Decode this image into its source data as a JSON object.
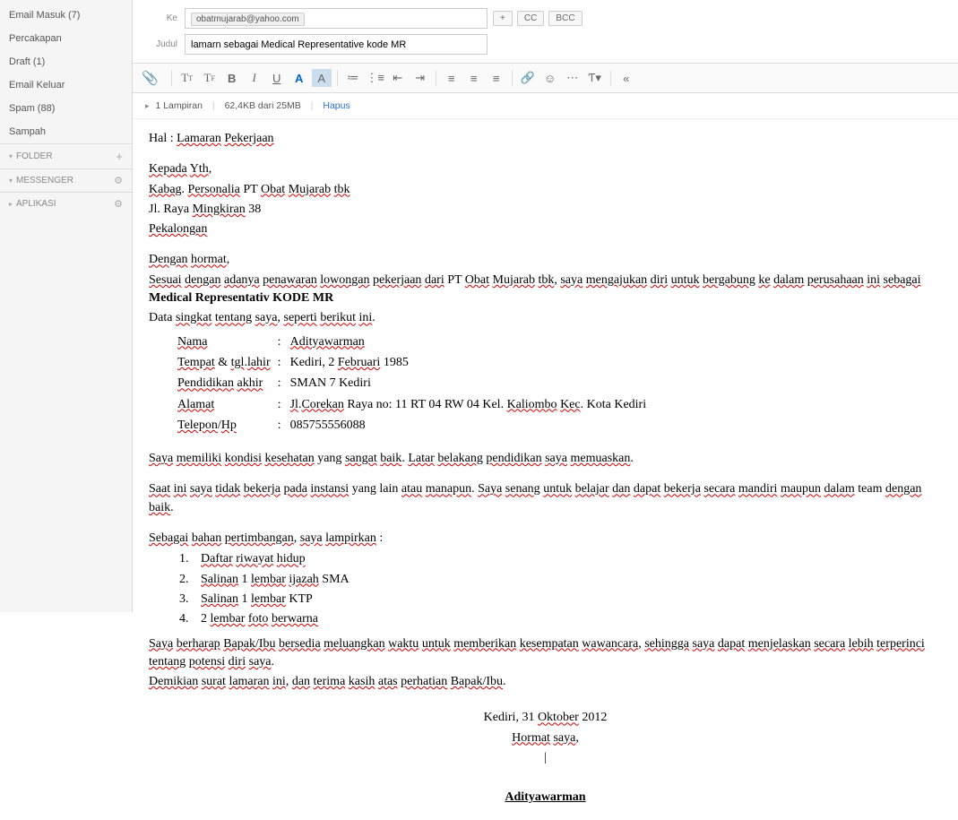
{
  "sidebar": {
    "items": [
      {
        "label": "Email Masuk (7)"
      },
      {
        "label": "Percakapan"
      },
      {
        "label": "Draft (1)"
      },
      {
        "label": "Email Keluar"
      },
      {
        "label": "Spam (88)"
      },
      {
        "label": "Sampah"
      }
    ],
    "sections": [
      {
        "label": "FOLDER"
      },
      {
        "label": "MESSENGER"
      },
      {
        "label": "APLIKASI"
      }
    ]
  },
  "compose": {
    "to_label": "Ke",
    "recipient": "obatmujarab@yahoo.com",
    "plus": "+",
    "cc": "CC",
    "bcc": "BCC",
    "subject_label": "Judul",
    "subject": "lamarn sebagai Medical Representative kode MR"
  },
  "toolbar": {
    "t1": "Tᴛ",
    "t2": "T𝔽",
    "bold": "B",
    "italic": "I",
    "underline": "U",
    "a1": "A",
    "a2": "A"
  },
  "attach": {
    "count": "1 Lampiran",
    "size": "62,4KB dari 25MB",
    "hapus": "Hapus"
  },
  "body": {
    "hal_prefix": "Hal : ",
    "hal": "Lamaran",
    "hal2": "Pekerjaan",
    "kepada": "Kepada",
    "yth": "Yth",
    "line2a": "Kabag",
    "line2b": "Personalia",
    "line2c": "PT",
    "line2d": "Obat",
    "line2e": "Mujarab",
    "line2f": "tbk",
    "line3a": "Jl. Raya",
    "line3b": "Mingkiran",
    "line3c": "38",
    "line4": "Pekalongan",
    "dengan": "Dengan",
    "hormat": "hormat",
    "p1a": "Sesuai",
    "p1b": "dengan",
    "p1c": "adanya",
    "p1d": "penawaran",
    "p1e": "lowongan",
    "p1f": "pekerjaan",
    "p1g": "dari",
    "p1h": "PT",
    "p1i": "Obat",
    "p1j": "Mujarab",
    "p1k": "tbk",
    "p1l": "saya",
    "p1m": "mengajukan",
    "p1n": "diri",
    "p1o": "untuk",
    "p1p": "bergabung",
    "p1q": "ke",
    "p1r": "dalam",
    "p1s": "perusahaan",
    "p1t": "ini",
    "p1u": "sebagai",
    "p1bold": "Medical Representativ KODE MR",
    "p2a": "Data",
    "p2b": "singkat",
    "p2c": "tentang",
    "p2d": "saya",
    "p2e": "seperti",
    "p2f": "berikut",
    "p2g": "ini",
    "info": {
      "r1k": "Nama",
      "r1v": "Adityawarman",
      "r2k": "Tempat",
      "r2k2": "tgl",
      "r2k3": "lahir",
      "r2v": "Kediri, 2 Februari 1985",
      "r2va": "Februari",
      "r3k": "Pendidikan",
      "r3k2": "akhir",
      "r3v": "SMAN 7 Kediri",
      "r4k": "Alamat",
      "r4v1": "Jl",
      "r4v2": "Corekan",
      "r4v3": "Raya no: 11 RT 04 RW 04 Kel.",
      "r4v4": "Kaliombo",
      "r4v5": "Kec",
      "r4v6": "Kota",
      "r4v7": "Kediri",
      "r5k": "Telepon",
      "r5k2": "Hp",
      "r5v": "085755556088"
    },
    "p3": "Saya memiliki kondisi kesehatan yang sangat baik. Latar belakang pendidikan saya memuaskan.",
    "p3w": [
      "Saya",
      "memiliki",
      "kondisi",
      "kesehatan",
      "yang",
      "sangat",
      "baik",
      "Latar",
      "belakang",
      "pendidikan",
      "saya",
      "memuaskan"
    ],
    "p4": "Saat ini saya tidak bekerja pada instansi yang lain atau manapun. Saya senang untuk belajar dan dapat bekerja secara mandiri maupun dalam team dengan baik.",
    "p5": "Sebagai bahan pertimbangan, saya lampirkan :",
    "list": [
      "Daftar riwayat hidup",
      "Salinan 1 lembar ijazah SMA",
      "Salinan 1 lembar KTP",
      "2 lembar foto berwarna"
    ],
    "p6": "Saya berharap Bapak/Ibu bersedia meluangkan waktu untuk memberikan kesempatan wawancara, sehingga saya dapat menjelaskan secara lebih terperinci tentang potensi diri saya.",
    "p7": "Demikian surat lamaran ini, dan terima kasih atas perhatian Bapak/Ibu.",
    "date": "Kediri, 31 Oktober 2012",
    "hormat_saya": "Hormat saya,",
    "signature": "Adityawarman"
  }
}
